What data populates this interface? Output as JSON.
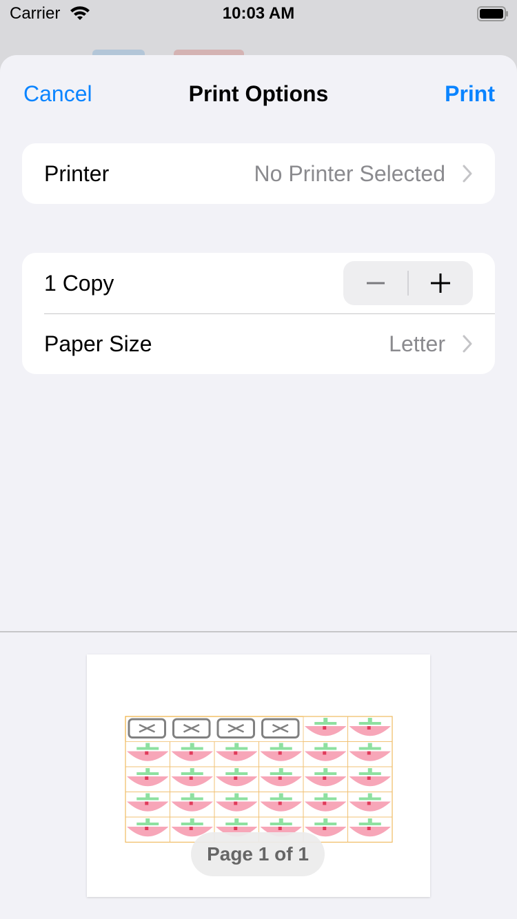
{
  "status_bar": {
    "carrier": "Carrier",
    "time": "10:03 AM"
  },
  "nav": {
    "cancel_label": "Cancel",
    "title": "Print Options",
    "print_label": "Print"
  },
  "printer_row": {
    "label": "Printer",
    "value": "No Printer Selected"
  },
  "copies_row": {
    "label": "1 Copy",
    "decrement_icon": "minus-icon",
    "increment_icon": "plus-icon"
  },
  "paper_row": {
    "label": "Paper Size",
    "value": "Letter"
  },
  "preview": {
    "page_indicator": "Page 1 of 1"
  },
  "colors": {
    "accent": "#0a84ff",
    "background": "#f2f2f7",
    "secondary_text": "#8a8a8e"
  }
}
